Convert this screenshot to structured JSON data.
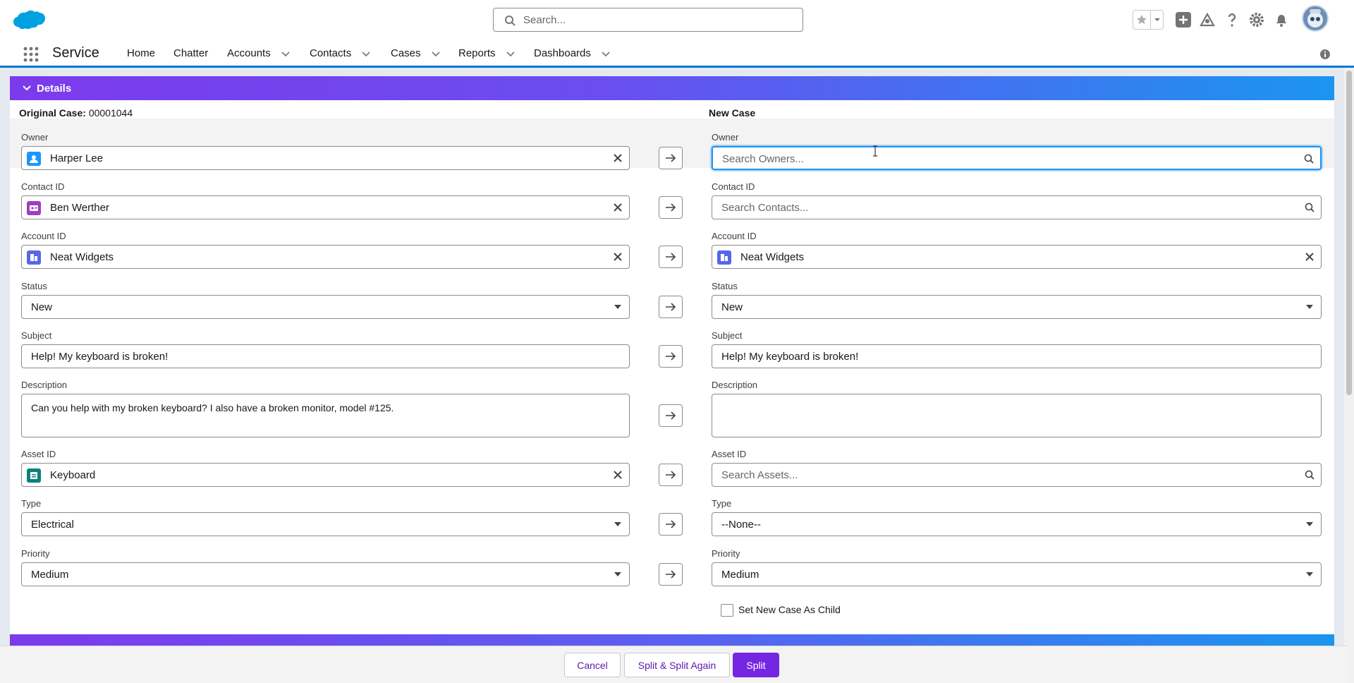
{
  "header": {
    "search_placeholder": "Search...",
    "app_name": "Service"
  },
  "nav": {
    "items": [
      {
        "label": "Home"
      },
      {
        "label": "Chatter"
      },
      {
        "label": "Accounts"
      },
      {
        "label": "Contacts"
      },
      {
        "label": "Cases"
      },
      {
        "label": "Reports"
      },
      {
        "label": "Dashboards"
      }
    ]
  },
  "section": {
    "title": "Details",
    "original_label": "Original Case:",
    "original_number": "00001044",
    "new_label": "New Case"
  },
  "original": {
    "owner_label": "Owner",
    "owner_value": "Harper Lee",
    "contact_label": "Contact ID",
    "contact_value": "Ben Werther",
    "account_label": "Account ID",
    "account_value": "Neat Widgets",
    "status_label": "Status",
    "status_value": "New",
    "subject_label": "Subject",
    "subject_value": "Help! My keyboard is broken!",
    "description_label": "Description",
    "description_value": "Can you help with my broken keyboard? I also have a broken monitor, model #125.",
    "asset_label": "Asset ID",
    "asset_value": "Keyboard",
    "type_label": "Type",
    "type_value": "Electrical",
    "priority_label": "Priority",
    "priority_value": "Medium"
  },
  "newcase": {
    "owner_label": "Owner",
    "owner_placeholder": "Search Owners...",
    "contact_label": "Contact ID",
    "contact_placeholder": "Search Contacts...",
    "account_label": "Account ID",
    "account_value": "Neat Widgets",
    "status_label": "Status",
    "status_value": "New",
    "subject_label": "Subject",
    "subject_value": "Help! My keyboard is broken!",
    "description_label": "Description",
    "description_value": "",
    "asset_label": "Asset ID",
    "asset_placeholder": "Search Assets...",
    "type_label": "Type",
    "type_value": "--None--",
    "priority_label": "Priority",
    "priority_value": "Medium",
    "child_checkbox_label": "Set New Case As Child",
    "child_checked": false
  },
  "footer": {
    "cancel": "Cancel",
    "split_again": "Split & Split Again",
    "split": "Split"
  },
  "colors": {
    "brand": "#7526e3",
    "focus": "#1b96ff",
    "nav_accent": "#0176d3"
  }
}
